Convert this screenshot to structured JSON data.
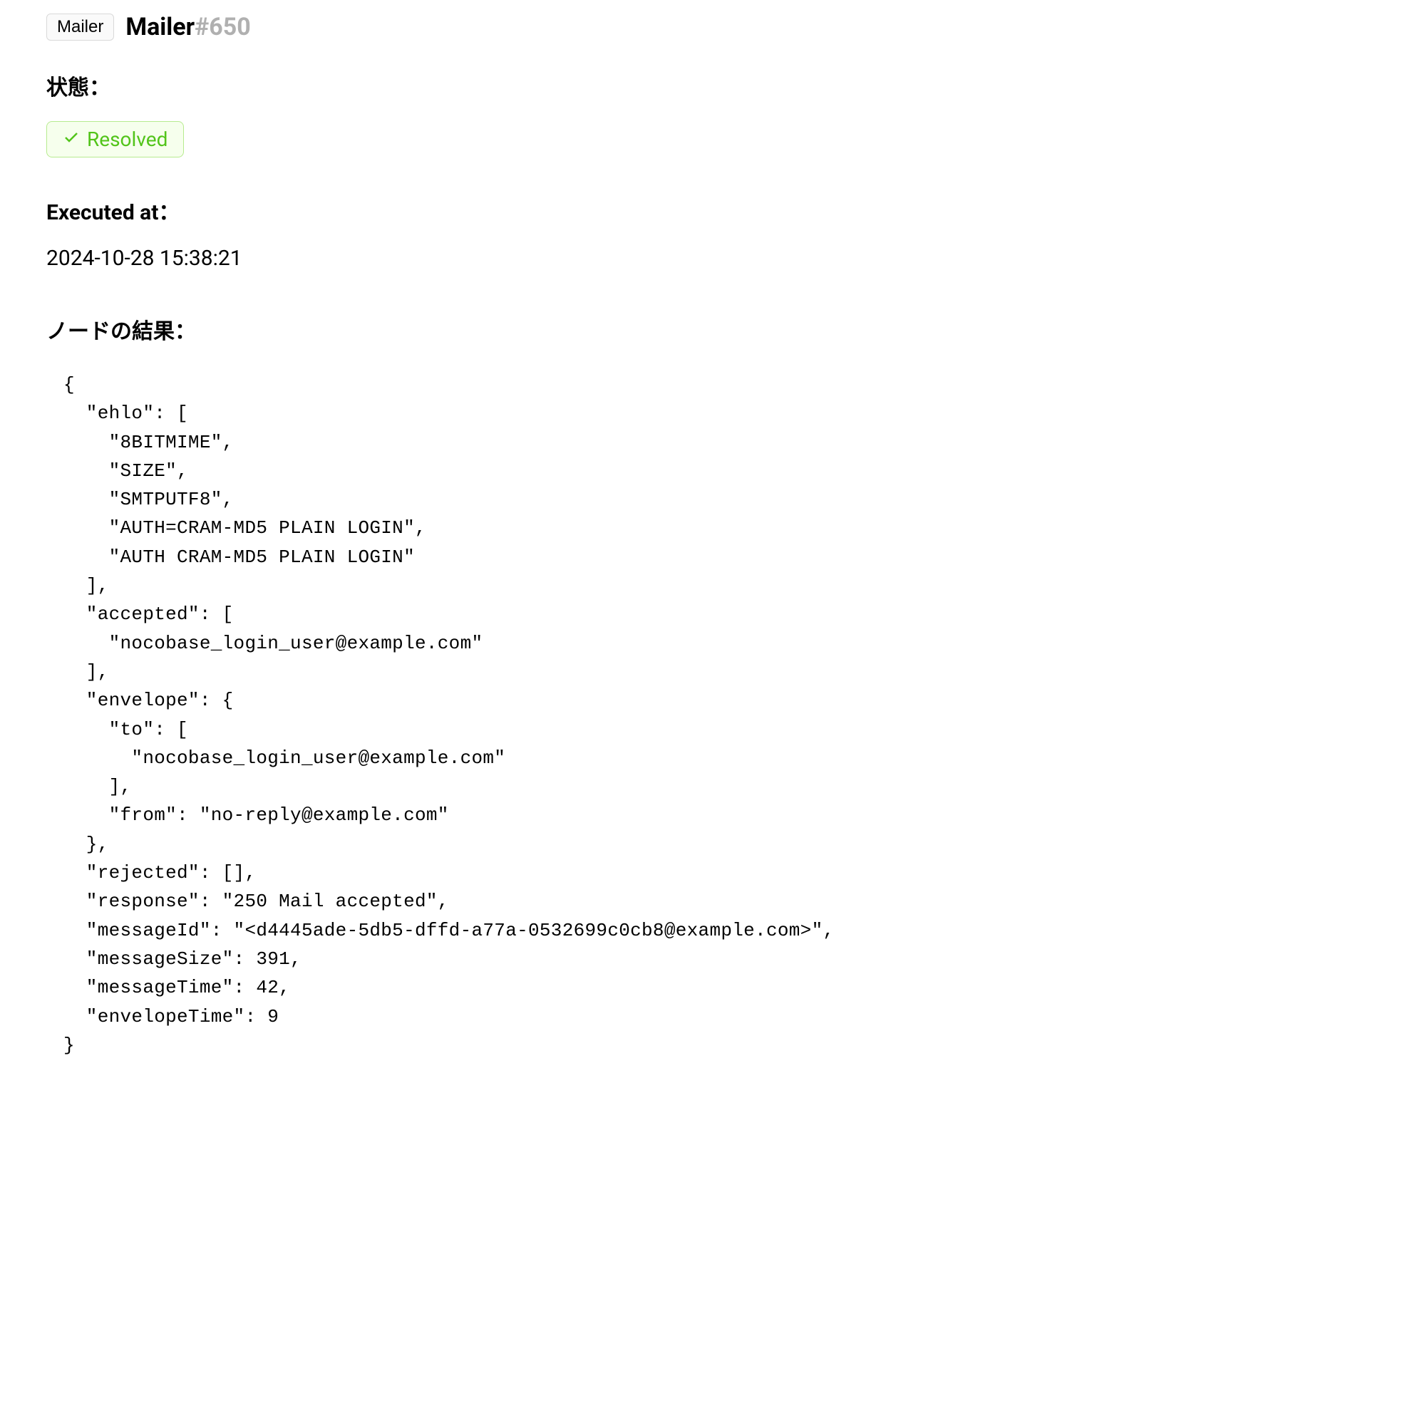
{
  "header": {
    "tag": "Mailer",
    "title": "Mailer",
    "id": "#650"
  },
  "status": {
    "label": "状態：",
    "value": "Resolved"
  },
  "executed": {
    "label": "Executed at：",
    "value": "2024-10-28 15:38:21"
  },
  "nodeResult": {
    "label": "ノードの結果：",
    "json": {
      "ehlo": [
        "8BITMIME",
        "SIZE",
        "SMTPUTF8",
        "AUTH=CRAM-MD5 PLAIN LOGIN",
        "AUTH CRAM-MD5 PLAIN LOGIN"
      ],
      "accepted": [
        "nocobase_login_user@example.com"
      ],
      "envelope": {
        "to": [
          "nocobase_login_user@example.com"
        ],
        "from": "no-reply@example.com"
      },
      "rejected": [],
      "response": "250 Mail accepted",
      "messageId": "<d4445ade-5db5-dffd-a77a-0532699c0cb8@example.com>",
      "messageSize": 391,
      "messageTime": 42,
      "envelopeTime": 9
    }
  }
}
